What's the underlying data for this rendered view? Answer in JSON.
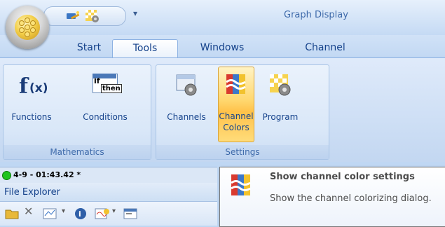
{
  "window": {
    "title": "Graph Display"
  },
  "qat": {
    "dropdown_glyph": "▾",
    "icons": [
      "wand-icon",
      "checker-gear-icon"
    ]
  },
  "tabs": [
    {
      "label": "Start",
      "active": false
    },
    {
      "label": "Tools",
      "active": true
    },
    {
      "label": "Windows",
      "active": false
    },
    {
      "label": "Channel",
      "active": false
    }
  ],
  "ribbon": {
    "groups": [
      {
        "label": "Mathematics",
        "buttons": [
          {
            "label": "Functions",
            "icon": "fx-icon"
          },
          {
            "label": "Conditions",
            "icon": "if-then-icon",
            "icon_text_if": "if",
            "icon_text_then": "then"
          }
        ]
      },
      {
        "label": "Settings",
        "buttons": [
          {
            "label": "Channels",
            "icon": "channels-gear-icon"
          },
          {
            "label_line1": "Channel",
            "label_line2": "Colors",
            "icon": "channel-colors-icon",
            "highlighted": true
          },
          {
            "label": "Program",
            "icon": "program-gear-icon"
          }
        ]
      }
    ]
  },
  "status": {
    "text": "4-9 - 01:43.42 *",
    "indicator_color": "#20c420"
  },
  "file_explorer": {
    "title": "File Explorer"
  },
  "tooltip": {
    "title": "Show channel color settings",
    "description": "Show the channel colorizing dialog."
  },
  "colors": {
    "accent": "#15428b",
    "ribbon_bg": "#cedff5",
    "highlight": "#ffd76e"
  }
}
